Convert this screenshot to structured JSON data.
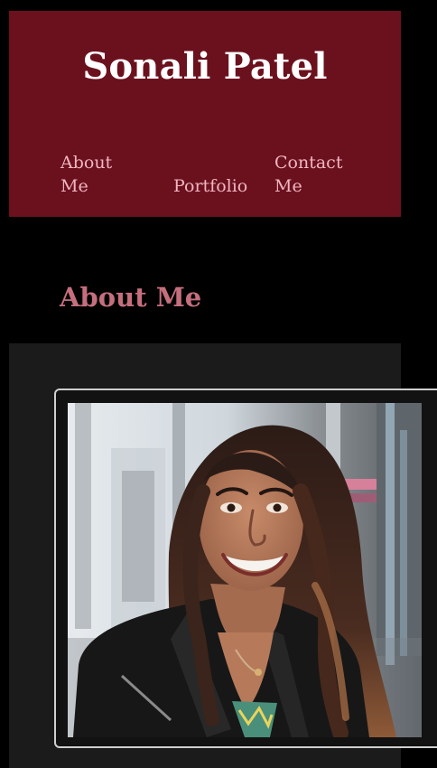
{
  "site": {
    "title": "Sonali Patel"
  },
  "nav": {
    "items": [
      {
        "label": "About Me"
      },
      {
        "label": "Portfolio"
      },
      {
        "label": "Contact Me"
      }
    ]
  },
  "about": {
    "heading": "About Me"
  },
  "colors": {
    "header_bg": "#6b111e",
    "nav_text": "#f1b6c0",
    "heading_text": "#c56f7d",
    "panel_bg": "#1c1b1c"
  },
  "icons": {
    "profile_photo": "profile-photo"
  }
}
